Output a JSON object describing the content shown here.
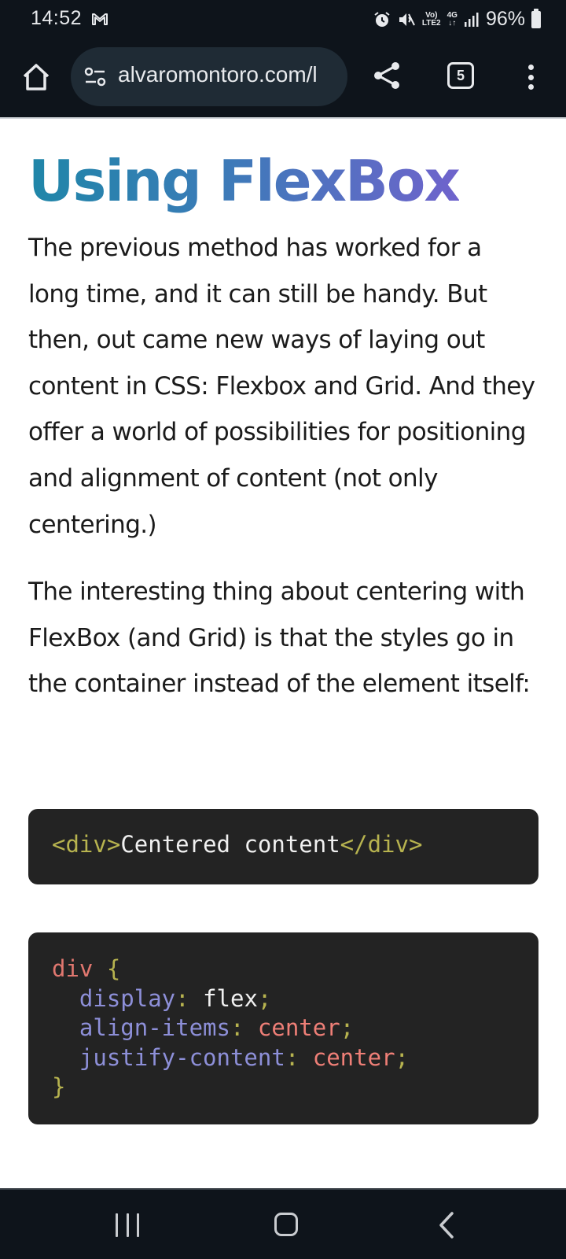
{
  "status_bar": {
    "time": "14:52",
    "signal_top": "Vo)",
    "signal_bottom": "LTE2",
    "network": "4G",
    "battery": "96%"
  },
  "browser": {
    "url": "alvaromontoro.com/l",
    "tab_count": "5",
    "colors": {
      "bar": "#0e141b",
      "urlbar": "#1f2b35"
    }
  },
  "article": {
    "heading": "Using FlexBox",
    "paragraphs": [
      "The previous method has worked for a long time, and it can still be handy. But then, out came new ways of laying out content in CSS: Flexbox and Grid. And they offer a world of possibilities for positioning and alignment of content (not only centering.)",
      "The interesting thing about centering with FlexBox (and Grid) is that the styles go in the container instead of the element itself:"
    ],
    "code_html": {
      "open_tag": "<div>",
      "text": "Centered content",
      "close_tag": "</div>"
    },
    "code_css": {
      "selector": "div",
      "open_brace": " {",
      "close_brace": "}",
      "declarations": [
        {
          "property": "display",
          "value": "flex"
        },
        {
          "property": "align-items",
          "value": "center"
        },
        {
          "property": "justify-content",
          "value": "center"
        }
      ]
    }
  },
  "icons": {
    "home": "home-icon",
    "site_settings": "site-settings-icon",
    "share": "share-icon",
    "tabs": "tab-switcher-icon",
    "menu": "more-vert-icon",
    "gmail": "gmail-icon",
    "alarm": "alarm-icon",
    "mute": "mute-icon",
    "nav_recents": "recents-icon",
    "nav_home": "nav-home-icon",
    "nav_back": "back-icon"
  }
}
